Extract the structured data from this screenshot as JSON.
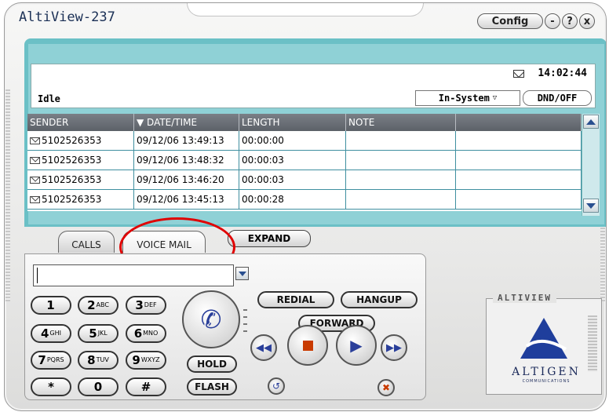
{
  "window": {
    "title": "AltiView-237",
    "config_label": "Config",
    "minimize_label": "-",
    "help_label": "?",
    "close_label": "x"
  },
  "status": {
    "state": "Idle",
    "time": "14:02:44",
    "presence": "In-System",
    "dnd": "DND/OFF"
  },
  "table": {
    "headers": [
      "SENDER",
      "▼ DATE/TIME",
      "LENGTH",
      "NOTE",
      ""
    ],
    "rows": [
      {
        "sender": "5102526353",
        "datetime": "09/12/06 13:49:13",
        "length": "00:00:00",
        "note": ""
      },
      {
        "sender": "5102526353",
        "datetime": "09/12/06 13:48:32",
        "length": "00:00:03",
        "note": ""
      },
      {
        "sender": "5102526353",
        "datetime": "09/12/06 13:46:20",
        "length": "00:00:03",
        "note": ""
      },
      {
        "sender": "5102526353",
        "datetime": "09/12/06 13:45:13",
        "length": "00:00:28",
        "note": ""
      }
    ]
  },
  "tabs": {
    "calls": "CALLS",
    "voicemail": "VOICE MAIL",
    "expand": "EXPAND"
  },
  "dialer": {
    "input_value": "",
    "keys": [
      {
        "digit": "1",
        "letters": ""
      },
      {
        "digit": "2",
        "letters": "ABC"
      },
      {
        "digit": "3",
        "letters": "DEF"
      },
      {
        "digit": "4",
        "letters": "GHI"
      },
      {
        "digit": "5",
        "letters": "JKL"
      },
      {
        "digit": "6",
        "letters": "MNO"
      },
      {
        "digit": "7",
        "letters": "PQRS"
      },
      {
        "digit": "8",
        "letters": "TUV"
      },
      {
        "digit": "9",
        "letters": "WXYZ"
      },
      {
        "digit": "*",
        "letters": ""
      },
      {
        "digit": "0",
        "letters": ""
      },
      {
        "digit": "#",
        "letters": ""
      }
    ],
    "redial": "REDIAL",
    "hangup": "HANGUP",
    "forward": "FORWARD",
    "hold": "HOLD",
    "flash": "FLASH"
  },
  "logo": {
    "section": "ALTIVIEW",
    "brand": "ALTIGEN",
    "sub": "COMMUNICATIONS"
  },
  "colors": {
    "panel": "#6bc0c6",
    "header": "#5c6168",
    "highlight_circle": "#e00000",
    "icon_blue": "#2a3f9a"
  }
}
